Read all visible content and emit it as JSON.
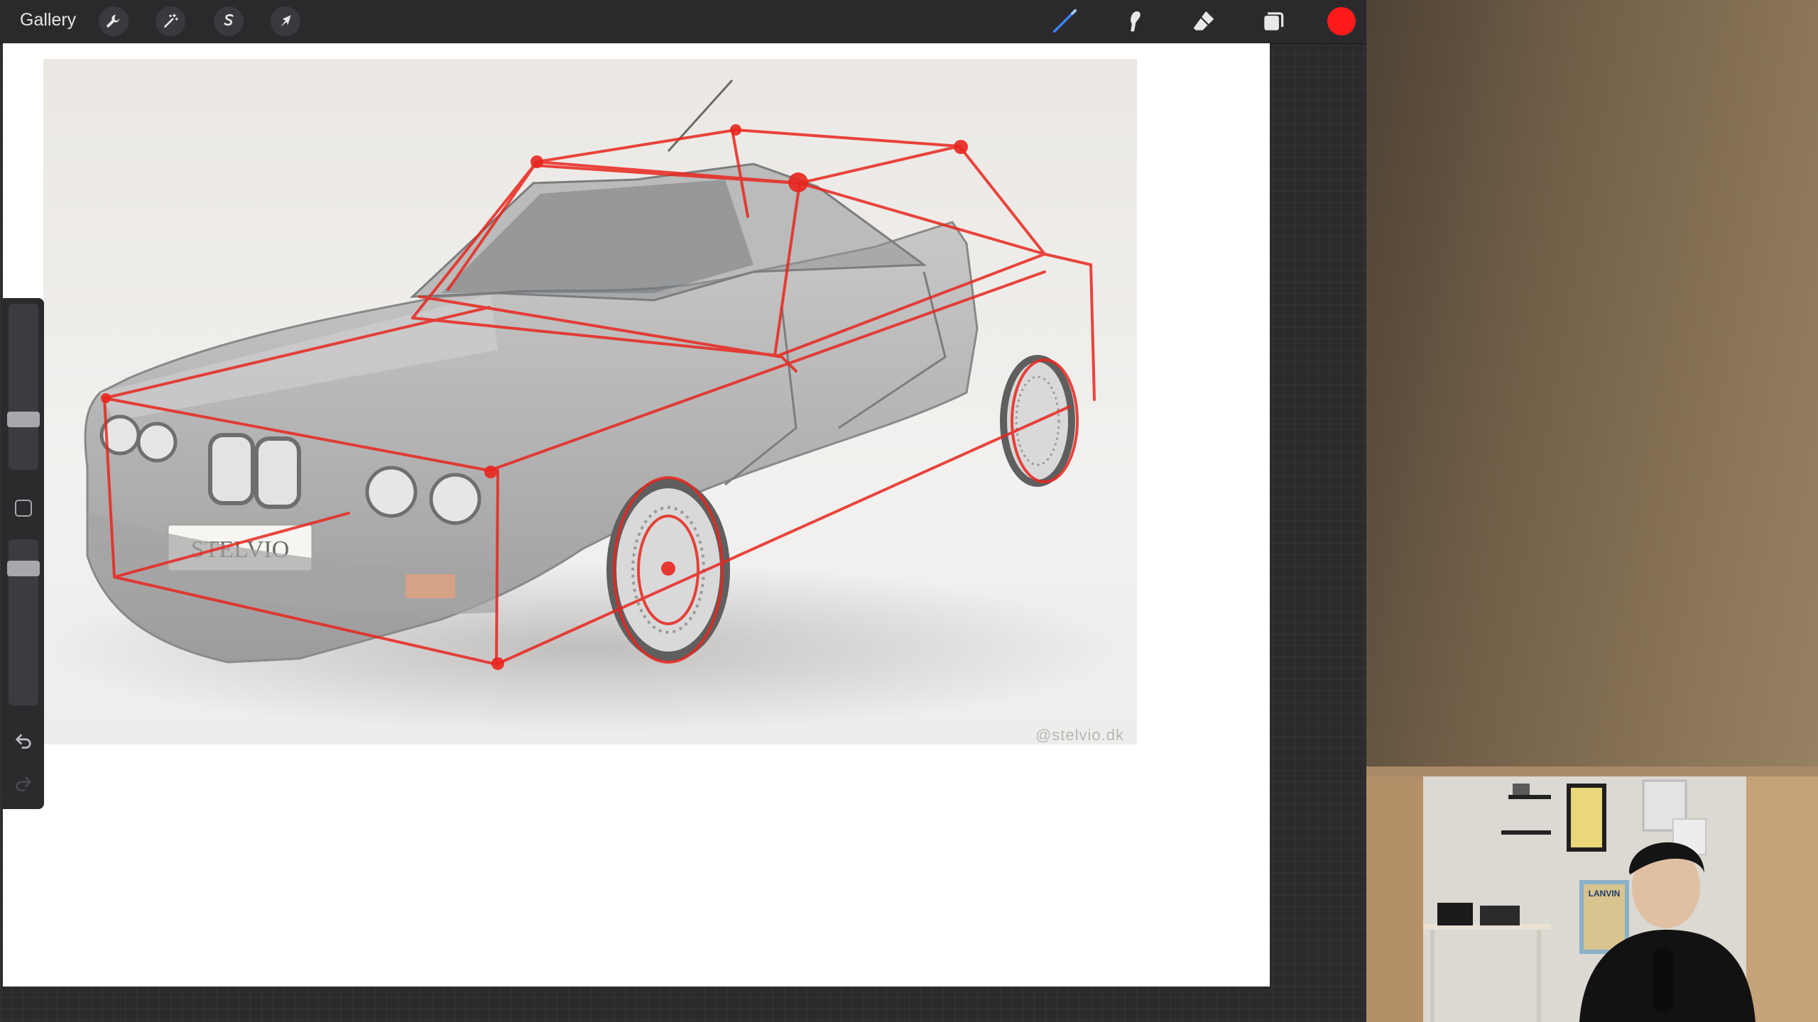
{
  "toolbar": {
    "gallery_label": "Gallery",
    "left_tools": [
      {
        "name": "actions",
        "icon": "wrench-icon"
      },
      {
        "name": "adjustments",
        "icon": "magic-wand-icon"
      },
      {
        "name": "selection",
        "icon": "selection-s-icon"
      },
      {
        "name": "transform",
        "icon": "arrow-cursor-icon"
      }
    ],
    "right_tools": [
      {
        "name": "brush",
        "icon": "brush-icon",
        "active": true
      },
      {
        "name": "smudge",
        "icon": "smudge-icon"
      },
      {
        "name": "eraser",
        "icon": "eraser-icon"
      },
      {
        "name": "layers",
        "icon": "layers-icon"
      }
    ],
    "current_color": "#ff1a1a",
    "active_tool_color": "#3b82f6"
  },
  "canvas": {
    "reference_image": {
      "subject": "silver sports coupe with red construction lines",
      "plate_text": "STELVIO",
      "watermark": "@stelvio.dk"
    },
    "sketch_color": "#e8261e"
  },
  "sidebar": {
    "brush_size_label": "Brush size",
    "opacity_label": "Opacity",
    "brush_size_level": 0.42,
    "opacity_level": 0.84,
    "modify_icon": "square-icon",
    "undo_icon": "undo-icon",
    "redo_icon": "redo-icon"
  },
  "webcam": {
    "poster_text": "LANVIN"
  }
}
